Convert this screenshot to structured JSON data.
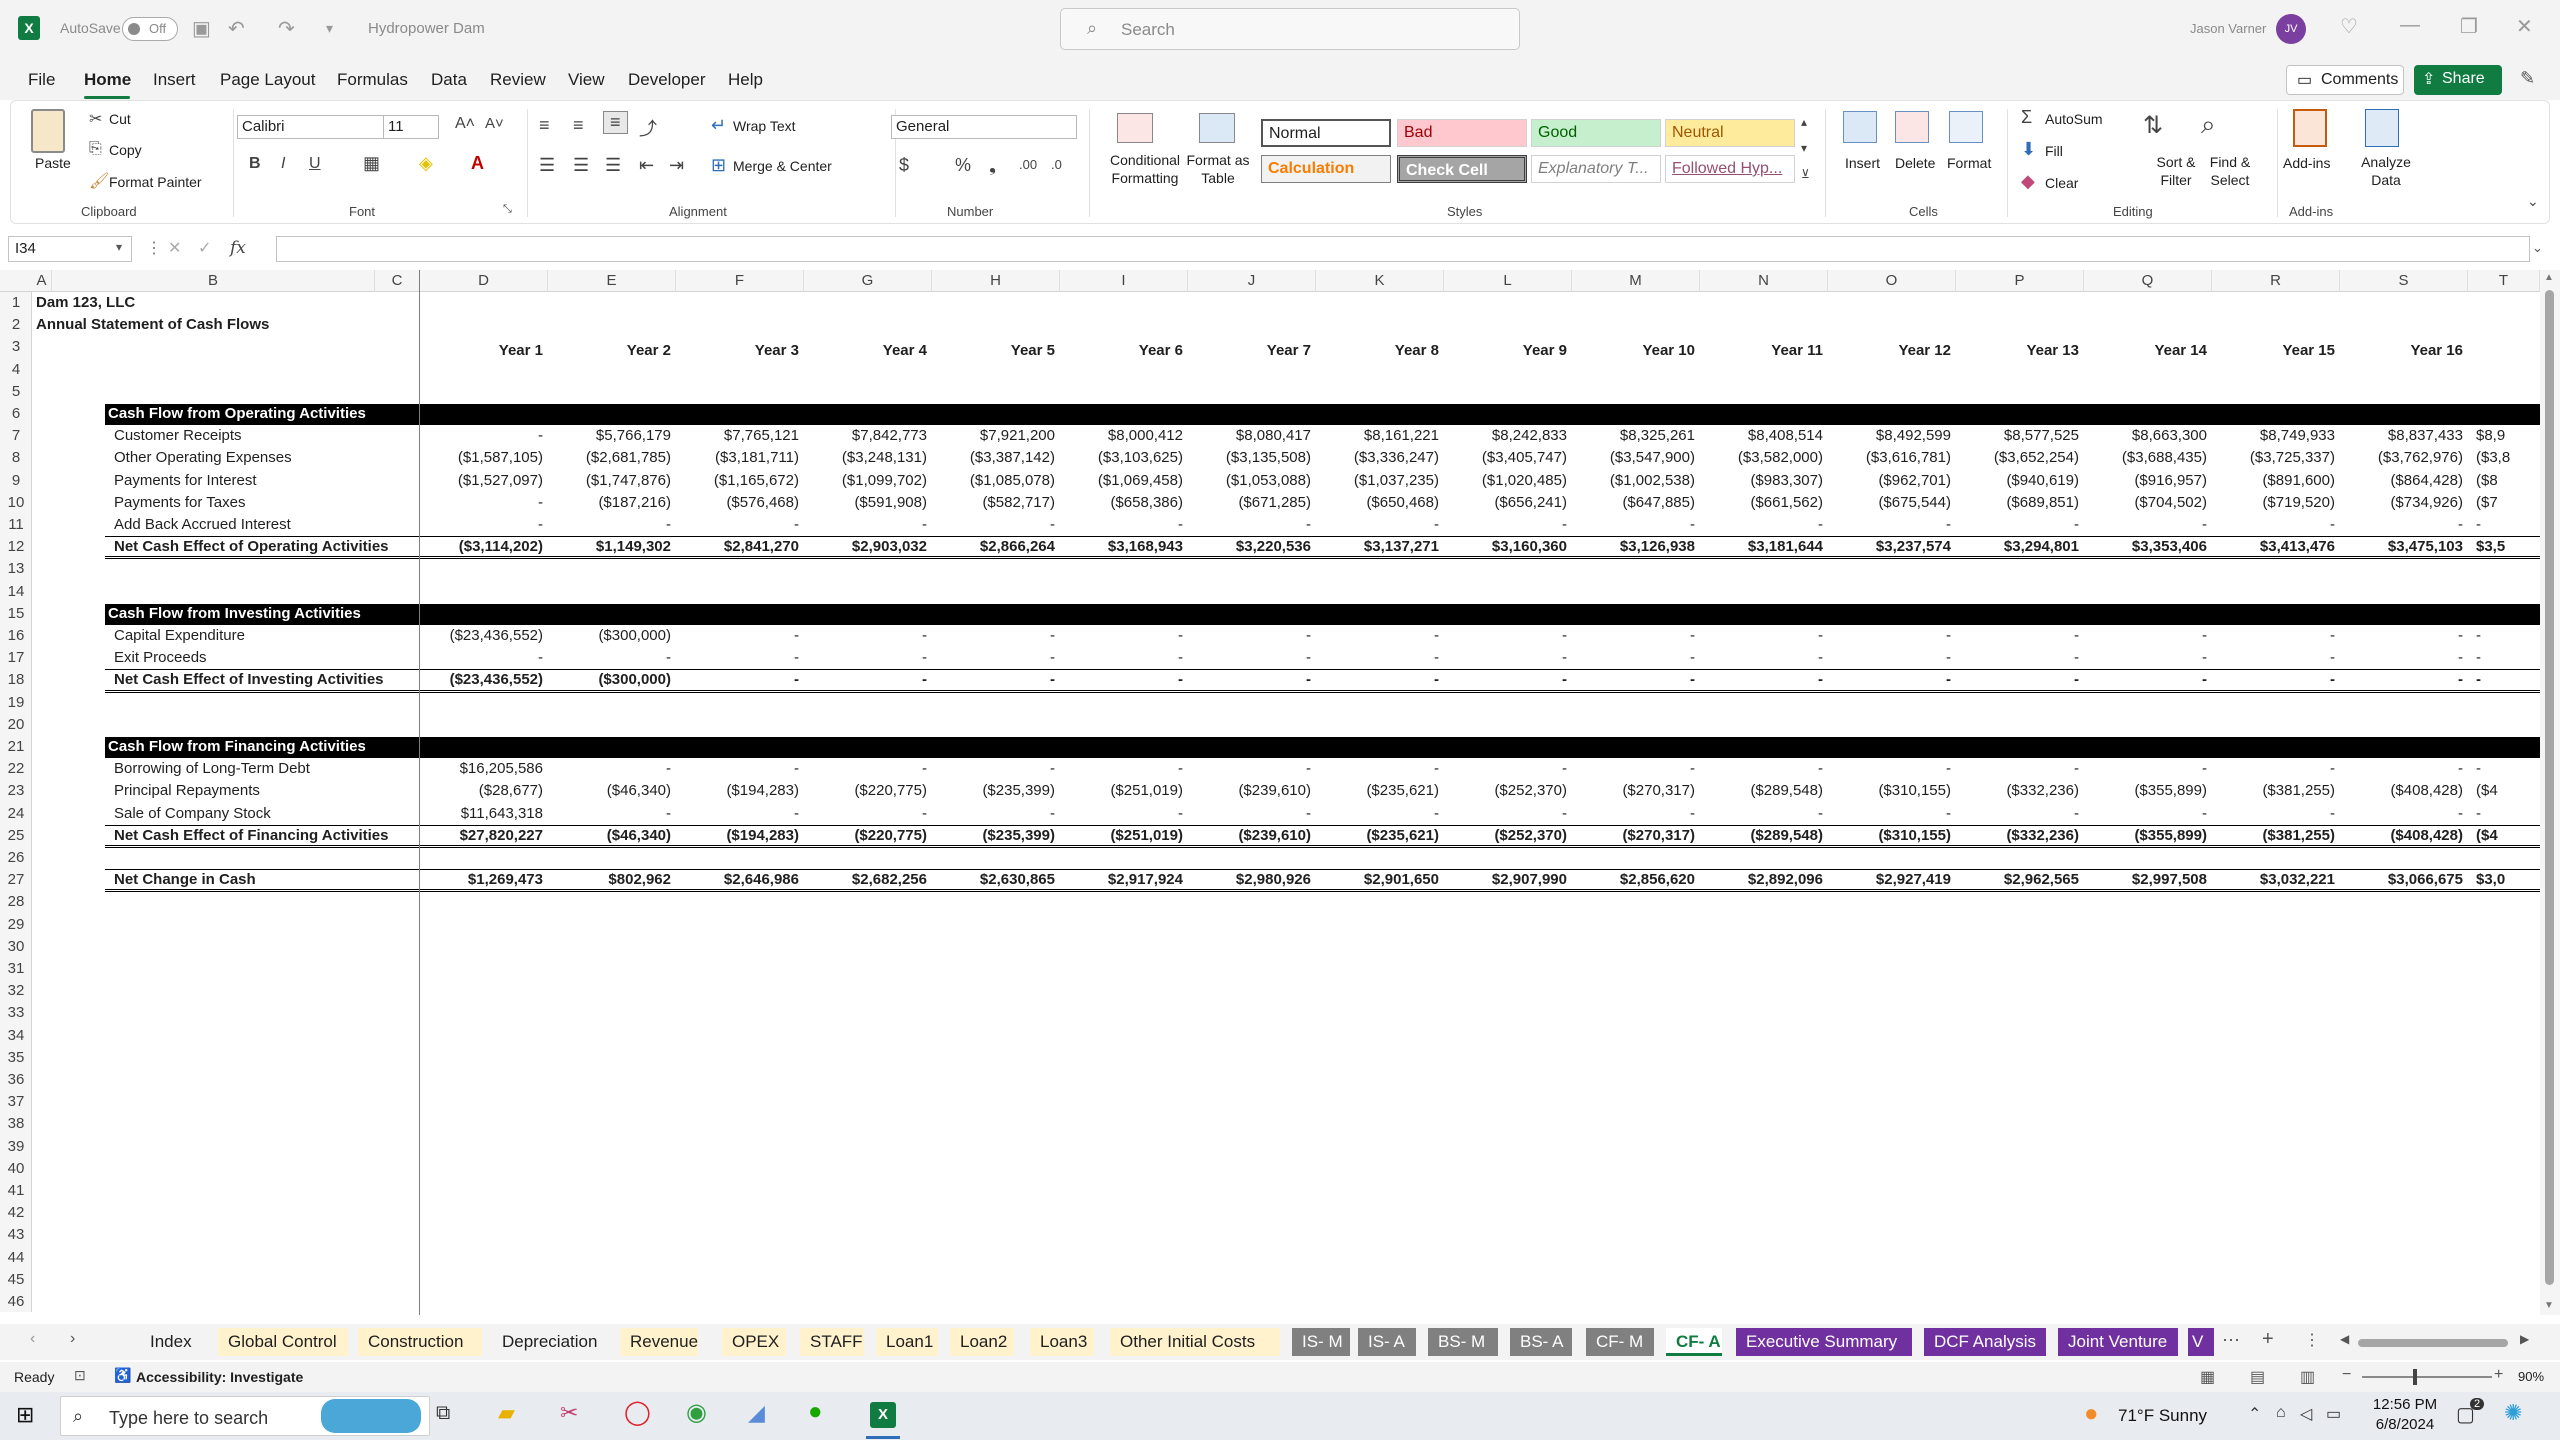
{
  "titlebar": {
    "autosave_label": "AutoSave",
    "autosave_state": "Off",
    "doc_title": "Hydropower Dam",
    "search_placeholder": "Search",
    "user_name": "Jason Varner",
    "user_initials": "JV"
  },
  "menu": {
    "tabs": [
      "File",
      "Home",
      "Insert",
      "Page Layout",
      "Formulas",
      "Data",
      "Review",
      "View",
      "Developer",
      "Help"
    ],
    "active": "Home",
    "comments_label": "Comments",
    "share_label": "Share"
  },
  "ribbon": {
    "clipboard": {
      "paste": "Paste",
      "cut": "Cut",
      "copy": "Copy",
      "format_painter": "Format Painter",
      "label": "Clipboard"
    },
    "font": {
      "name": "Calibri",
      "size": "11",
      "label": "Font"
    },
    "alignment": {
      "wrap_text": "Wrap Text",
      "merge_center": "Merge & Center",
      "label": "Alignment"
    },
    "number": {
      "format": "General",
      "label": "Number"
    },
    "styles": {
      "conditional_formatting": "Conditional Formatting",
      "format_as_table": "Format as Table",
      "cells": [
        "Normal",
        "Bad",
        "Good",
        "Neutral",
        "Calculation",
        "Check Cell",
        "Explanatory T...",
        "Followed Hyp..."
      ],
      "label": "Styles"
    },
    "cells": {
      "insert": "Insert",
      "delete": "Delete",
      "format": "Format",
      "label": "Cells"
    },
    "editing": {
      "autosum": "AutoSum",
      "fill": "Fill",
      "clear": "Clear",
      "sort_filter": "Sort & Filter",
      "find_select": "Find & Select",
      "label": "Editing"
    },
    "addins": {
      "addins": "Add-ins",
      "analyze_data": "Analyze Data",
      "label": "Add-ins"
    }
  },
  "formula_bar": {
    "name_box": "I34",
    "fx": "fx",
    "formula": ""
  },
  "sheet": {
    "columns": [
      "A",
      "B",
      "C",
      "D",
      "E",
      "F",
      "G",
      "H",
      "I",
      "J",
      "K",
      "L",
      "M",
      "N",
      "O",
      "P",
      "Q",
      "R",
      "S",
      "T"
    ],
    "rows": [
      "1",
      "2",
      "3",
      "4",
      "5",
      "6",
      "7",
      "8",
      "9",
      "10",
      "11",
      "12",
      "13",
      "14",
      "15",
      "16",
      "17",
      "18",
      "19",
      "20",
      "21",
      "22",
      "23",
      "24",
      "25",
      "26",
      "27",
      "28",
      "29",
      "30",
      "31",
      "32",
      "33",
      "34",
      "35",
      "36",
      "37",
      "38",
      "39",
      "40",
      "41",
      "42",
      "43",
      "44",
      "45",
      "46"
    ],
    "company": "Dam 123, LLC",
    "statement_title": "Annual Statement of Cash Flows",
    "years": [
      "Year 1",
      "Year 2",
      "Year 3",
      "Year 4",
      "Year 5",
      "Year 6",
      "Year 7",
      "Year 8",
      "Year 9",
      "Year 10",
      "Year 11",
      "Year 12",
      "Year 13",
      "Year 14",
      "Year 15",
      "Year 16"
    ],
    "operating": {
      "header": "Cash Flow from Operating Activities",
      "lines": [
        {
          "label": "Customer Receipts",
          "values": [
            "-",
            "$5,766,179",
            "$7,765,121",
            "$7,842,773",
            "$7,921,200",
            "$8,000,412",
            "$8,080,417",
            "$8,161,221",
            "$8,242,833",
            "$8,325,261",
            "$8,408,514",
            "$8,492,599",
            "$8,577,525",
            "$8,663,300",
            "$8,749,933",
            "$8,837,433",
            "$8,9"
          ]
        },
        {
          "label": "Other Operating Expenses",
          "values": [
            "($1,587,105)",
            "($2,681,785)",
            "($3,181,711)",
            "($3,248,131)",
            "($3,387,142)",
            "($3,103,625)",
            "($3,135,508)",
            "($3,336,247)",
            "($3,405,747)",
            "($3,547,900)",
            "($3,582,000)",
            "($3,616,781)",
            "($3,652,254)",
            "($3,688,435)",
            "($3,725,337)",
            "($3,762,976)",
            "($3,8"
          ]
        },
        {
          "label": "Payments for Interest",
          "values": [
            "($1,527,097)",
            "($1,747,876)",
            "($1,165,672)",
            "($1,099,702)",
            "($1,085,078)",
            "($1,069,458)",
            "($1,053,088)",
            "($1,037,235)",
            "($1,020,485)",
            "($1,002,538)",
            "($983,307)",
            "($962,701)",
            "($940,619)",
            "($916,957)",
            "($891,600)",
            "($864,428)",
            "($8"
          ]
        },
        {
          "label": "Payments for Taxes",
          "values": [
            "-",
            "($187,216)",
            "($576,468)",
            "($591,908)",
            "($582,717)",
            "($658,386)",
            "($671,285)",
            "($650,468)",
            "($656,241)",
            "($647,885)",
            "($661,562)",
            "($675,544)",
            "($689,851)",
            "($704,502)",
            "($719,520)",
            "($734,926)",
            "($7"
          ]
        },
        {
          "label": "Add Back Accrued Interest",
          "values": [
            "-",
            "-",
            "-",
            "-",
            "-",
            "-",
            "-",
            "-",
            "-",
            "-",
            "-",
            "-",
            "-",
            "-",
            "-",
            "-",
            "-"
          ]
        }
      ],
      "total_label": "Net Cash Effect of Operating Activities",
      "totals": [
        "($3,114,202)",
        "$1,149,302",
        "$2,841,270",
        "$2,903,032",
        "$2,866,264",
        "$3,168,943",
        "$3,220,536",
        "$3,137,271",
        "$3,160,360",
        "$3,126,938",
        "$3,181,644",
        "$3,237,574",
        "$3,294,801",
        "$3,353,406",
        "$3,413,476",
        "$3,475,103",
        "$3,5"
      ]
    },
    "investing": {
      "header": "Cash Flow from Investing Activities",
      "lines": [
        {
          "label": "Capital Expenditure",
          "values": [
            "($23,436,552)",
            "($300,000)",
            "-",
            "-",
            "-",
            "-",
            "-",
            "-",
            "-",
            "-",
            "-",
            "-",
            "-",
            "-",
            "-",
            "-",
            "-"
          ]
        },
        {
          "label": "Exit Proceeds",
          "values": [
            "-",
            "-",
            "-",
            "-",
            "-",
            "-",
            "-",
            "-",
            "-",
            "-",
            "-",
            "-",
            "-",
            "-",
            "-",
            "-",
            "-"
          ]
        }
      ],
      "total_label": "Net Cash Effect of Investing Activities",
      "totals": [
        "($23,436,552)",
        "($300,000)",
        "-",
        "-",
        "-",
        "-",
        "-",
        "-",
        "-",
        "-",
        "-",
        "-",
        "-",
        "-",
        "-",
        "-",
        "-"
      ]
    },
    "financing": {
      "header": "Cash Flow from Financing Activities",
      "lines": [
        {
          "label": "Borrowing of Long-Term Debt",
          "values": [
            "$16,205,586",
            "-",
            "-",
            "-",
            "-",
            "-",
            "-",
            "-",
            "-",
            "-",
            "-",
            "-",
            "-",
            "-",
            "-",
            "-",
            "-"
          ]
        },
        {
          "label": "Principal Repayments",
          "values": [
            "($28,677)",
            "($46,340)",
            "($194,283)",
            "($220,775)",
            "($235,399)",
            "($251,019)",
            "($239,610)",
            "($235,621)",
            "($252,370)",
            "($270,317)",
            "($289,548)",
            "($310,155)",
            "($332,236)",
            "($355,899)",
            "($381,255)",
            "($408,428)",
            "($4"
          ]
        },
        {
          "label": "Sale of Company Stock",
          "values": [
            "$11,643,318",
            "-",
            "-",
            "-",
            "-",
            "-",
            "-",
            "-",
            "-",
            "-",
            "-",
            "-",
            "-",
            "-",
            "-",
            "-",
            "-"
          ]
        }
      ],
      "total_label": "Net Cash Effect of Financing Activities",
      "totals": [
        "$27,820,227",
        "($46,340)",
        "($194,283)",
        "($220,775)",
        "($235,399)",
        "($251,019)",
        "($239,610)",
        "($235,621)",
        "($252,370)",
        "($270,317)",
        "($289,548)",
        "($310,155)",
        "($332,236)",
        "($355,899)",
        "($381,255)",
        "($408,428)",
        "($4"
      ]
    },
    "net_change_label": "Net Change in Cash",
    "net_change": [
      "$1,269,473",
      "$802,962",
      "$2,646,986",
      "$2,682,256",
      "$2,630,865",
      "$2,917,924",
      "$2,980,926",
      "$2,901,650",
      "$2,907,990",
      "$2,856,620",
      "$2,892,096",
      "$2,927,419",
      "$2,962,565",
      "$2,997,508",
      "$3,032,221",
      "$3,066,675",
      "$3,0"
    ]
  },
  "sheet_tabs": [
    {
      "name": "Index",
      "bg": "#f3f3f3",
      "fg": "#1f1f1f"
    },
    {
      "name": "Global Control",
      "bg": "#fff2cc",
      "fg": "#1f1f1f"
    },
    {
      "name": "Construction",
      "bg": "#fff2cc",
      "fg": "#1f1f1f"
    },
    {
      "name": "Depreciation",
      "bg": "#f3f3f3",
      "fg": "#1f1f1f"
    },
    {
      "name": "Revenue",
      "bg": "#fff2cc",
      "fg": "#1f1f1f"
    },
    {
      "name": "OPEX",
      "bg": "#fff2cc",
      "fg": "#1f1f1f"
    },
    {
      "name": "STAFF",
      "bg": "#fff2cc",
      "fg": "#1f1f1f"
    },
    {
      "name": "Loan1",
      "bg": "#fff2cc",
      "fg": "#1f1f1f"
    },
    {
      "name": "Loan2",
      "bg": "#fff2cc",
      "fg": "#1f1f1f"
    },
    {
      "name": "Loan3",
      "bg": "#fff2cc",
      "fg": "#1f1f1f"
    },
    {
      "name": "Other Initial Costs",
      "bg": "#fff2cc",
      "fg": "#1f1f1f"
    },
    {
      "name": "IS- M",
      "bg": "#808080",
      "fg": "#ffffff"
    },
    {
      "name": "IS- A",
      "bg": "#808080",
      "fg": "#ffffff"
    },
    {
      "name": "BS- M",
      "bg": "#808080",
      "fg": "#ffffff"
    },
    {
      "name": "BS- A",
      "bg": "#808080",
      "fg": "#ffffff"
    },
    {
      "name": "CF- M",
      "bg": "#808080",
      "fg": "#ffffff"
    },
    {
      "name": "CF- A",
      "bg": "#ffffff",
      "fg": "#107c41"
    },
    {
      "name": "Executive Summary",
      "bg": "#7030a0",
      "fg": "#ffffff"
    },
    {
      "name": "DCF Analysis",
      "bg": "#7030a0",
      "fg": "#ffffff"
    },
    {
      "name": "Joint Venture",
      "bg": "#7030a0",
      "fg": "#ffffff"
    },
    {
      "name": "V",
      "bg": "#7030a0",
      "fg": "#ffffff"
    }
  ],
  "status": {
    "ready": "Ready",
    "accessibility": "Accessibility: Investigate",
    "zoom": "90%"
  },
  "taskbar": {
    "search_placeholder": "Type here to search",
    "weather": "71°F  Sunny",
    "time": "12:56 PM",
    "date": "6/8/2024",
    "notif_count": "2"
  },
  "colors": {
    "excel_green": "#107c41",
    "purple_tab": "#7030a0",
    "grey_tab": "#808080",
    "yellow_tab": "#fff2cc"
  }
}
